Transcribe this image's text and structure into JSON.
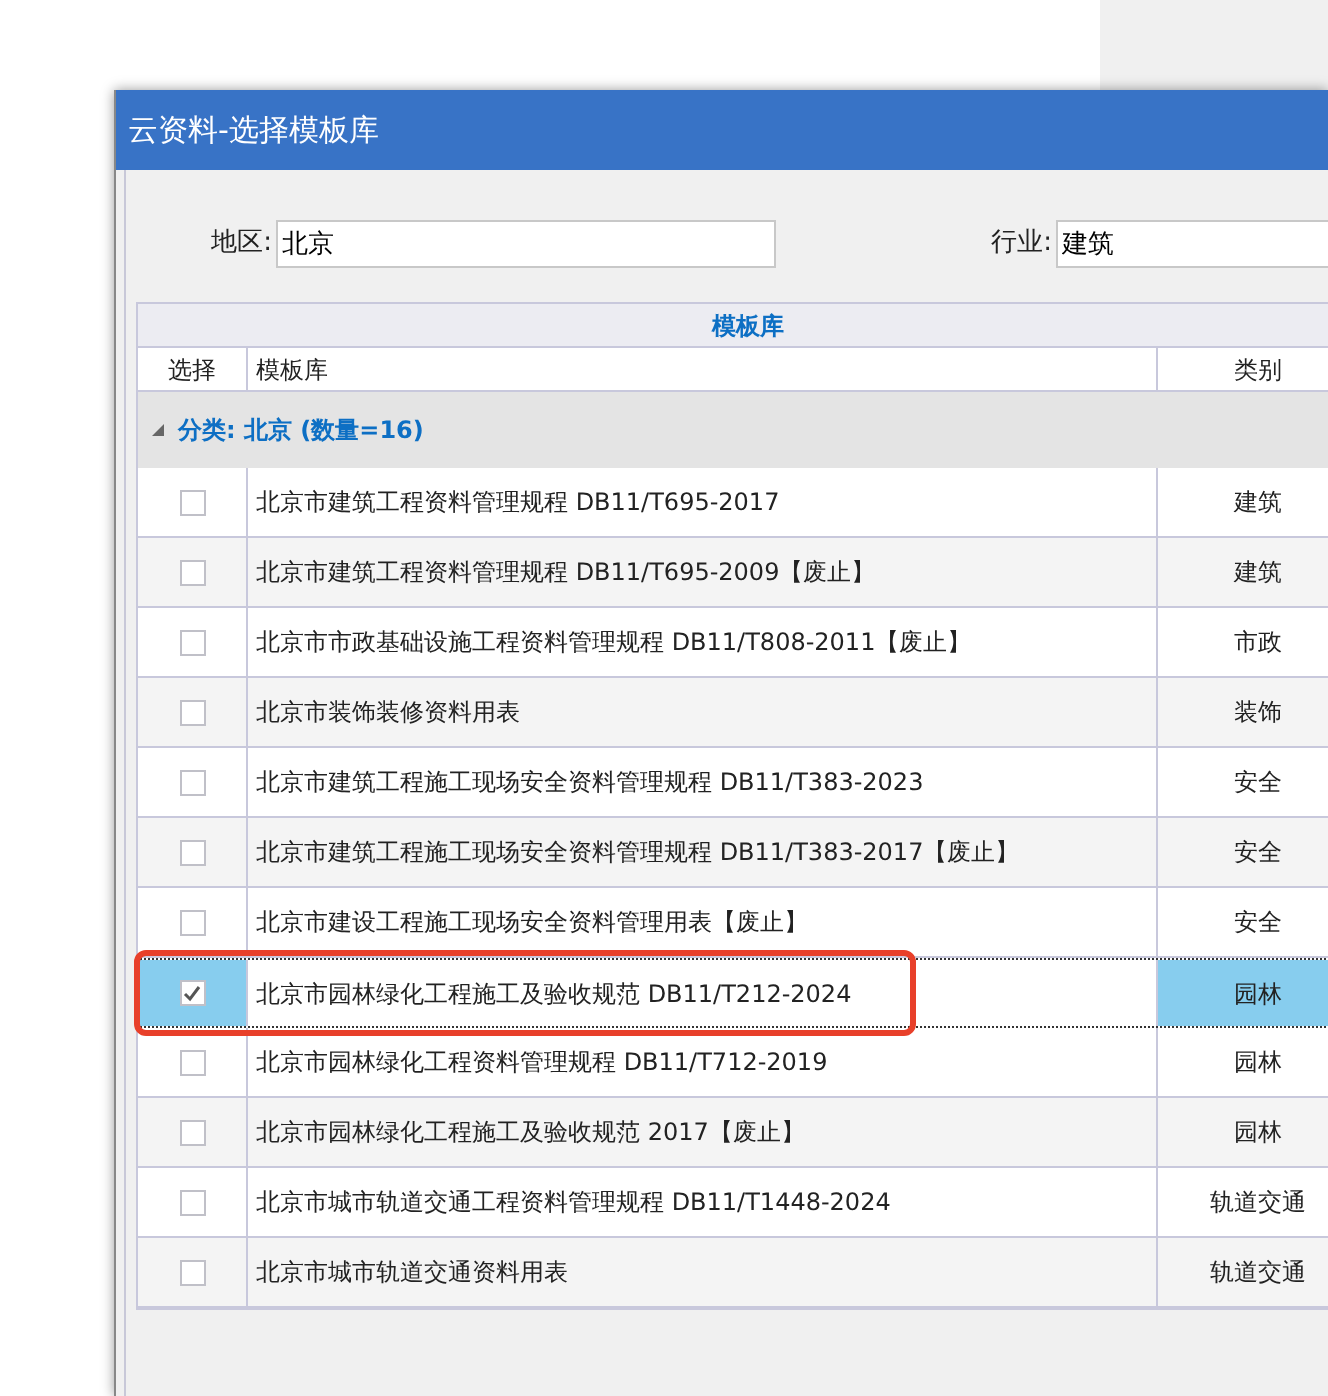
{
  "dialog": {
    "title": "云资料-选择模板库"
  },
  "filters": [
    {
      "label": "地区:",
      "value": "北京"
    },
    {
      "label": "行业:",
      "value": "建筑"
    }
  ],
  "grid": {
    "band_header": "模板库",
    "columns": [
      "选择",
      "模板库",
      "类别"
    ],
    "group": {
      "label": "分类: 北京 (数量=16)",
      "expanded": true
    },
    "rows": [
      {
        "name": "北京市建筑工程资料管理规程 DB11/T695-2017",
        "category": "建筑",
        "checked": false,
        "selected": false
      },
      {
        "name": "北京市建筑工程资料管理规程 DB11/T695-2009【废止】",
        "category": "建筑",
        "checked": false,
        "selected": false
      },
      {
        "name": "北京市市政基础设施工程资料管理规程 DB11/T808-2011【废止】",
        "category": "市政",
        "checked": false,
        "selected": false
      },
      {
        "name": "北京市装饰装修资料用表",
        "category": "装饰",
        "checked": false,
        "selected": false
      },
      {
        "name": "北京市建筑工程施工现场安全资料管理规程 DB11/T383-2023",
        "category": "安全",
        "checked": false,
        "selected": false
      },
      {
        "name": "北京市建筑工程施工现场安全资料管理规程 DB11/T383-2017【废止】",
        "category": "安全",
        "checked": false,
        "selected": false
      },
      {
        "name": "北京市建设工程施工现场安全资料管理用表【废止】",
        "category": "安全",
        "checked": false,
        "selected": false
      },
      {
        "name": "北京市园林绿化工程施工及验收规范 DB11/T212-2024",
        "category": "园林",
        "checked": true,
        "selected": true
      },
      {
        "name": "北京市园林绿化工程资料管理规程 DB11/T712-2019",
        "category": "园林",
        "checked": false,
        "selected": false
      },
      {
        "name": "北京市园林绿化工程施工及验收规范 2017【废止】",
        "category": "园林",
        "checked": false,
        "selected": false
      },
      {
        "name": "北京市城市轨道交通工程资料管理规程 DB11/T1448-2024",
        "category": "轨道交通",
        "checked": false,
        "selected": false
      },
      {
        "name": "北京市城市轨道交通资料用表",
        "category": "轨道交通",
        "checked": false,
        "selected": false
      }
    ]
  }
}
